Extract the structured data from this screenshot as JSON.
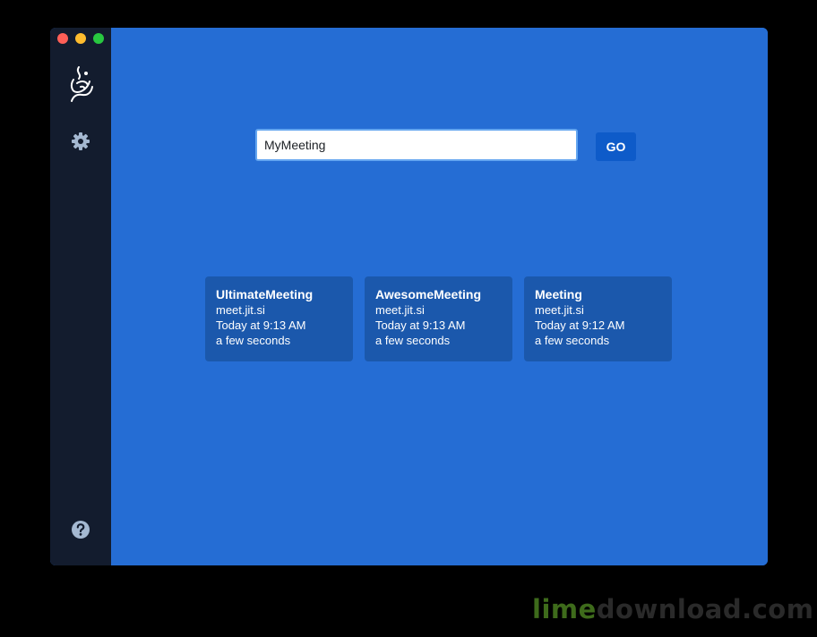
{
  "window": {
    "traffic_lights": [
      "close",
      "minimize",
      "maximize"
    ]
  },
  "sidebar": {
    "logo_icon": "jitsi-logo-icon",
    "settings_icon": "gear-icon",
    "help_icon": "question-circle-icon"
  },
  "room_entry": {
    "value": "MyMeeting",
    "go_label": "GO"
  },
  "recent_meetings": [
    {
      "room": "UltimateMeeting",
      "server": "meet.jit.si",
      "date": "Today at 9:13 AM",
      "duration": "a few seconds"
    },
    {
      "room": "AwesomeMeeting",
      "server": "meet.jit.si",
      "date": "Today at 9:13 AM",
      "duration": "a few seconds"
    },
    {
      "room": "Meeting",
      "server": "meet.jit.si",
      "date": "Today at 9:12 AM",
      "duration": "a few seconds"
    }
  ],
  "watermark": {
    "part1": "lime",
    "part2": "download.com"
  },
  "colors": {
    "main_background": "#256dd4",
    "sidebar_background": "#131c2e",
    "card_background": "#1b58ac",
    "go_button": "#0e5bc9",
    "input_border": "#64a6f0"
  }
}
